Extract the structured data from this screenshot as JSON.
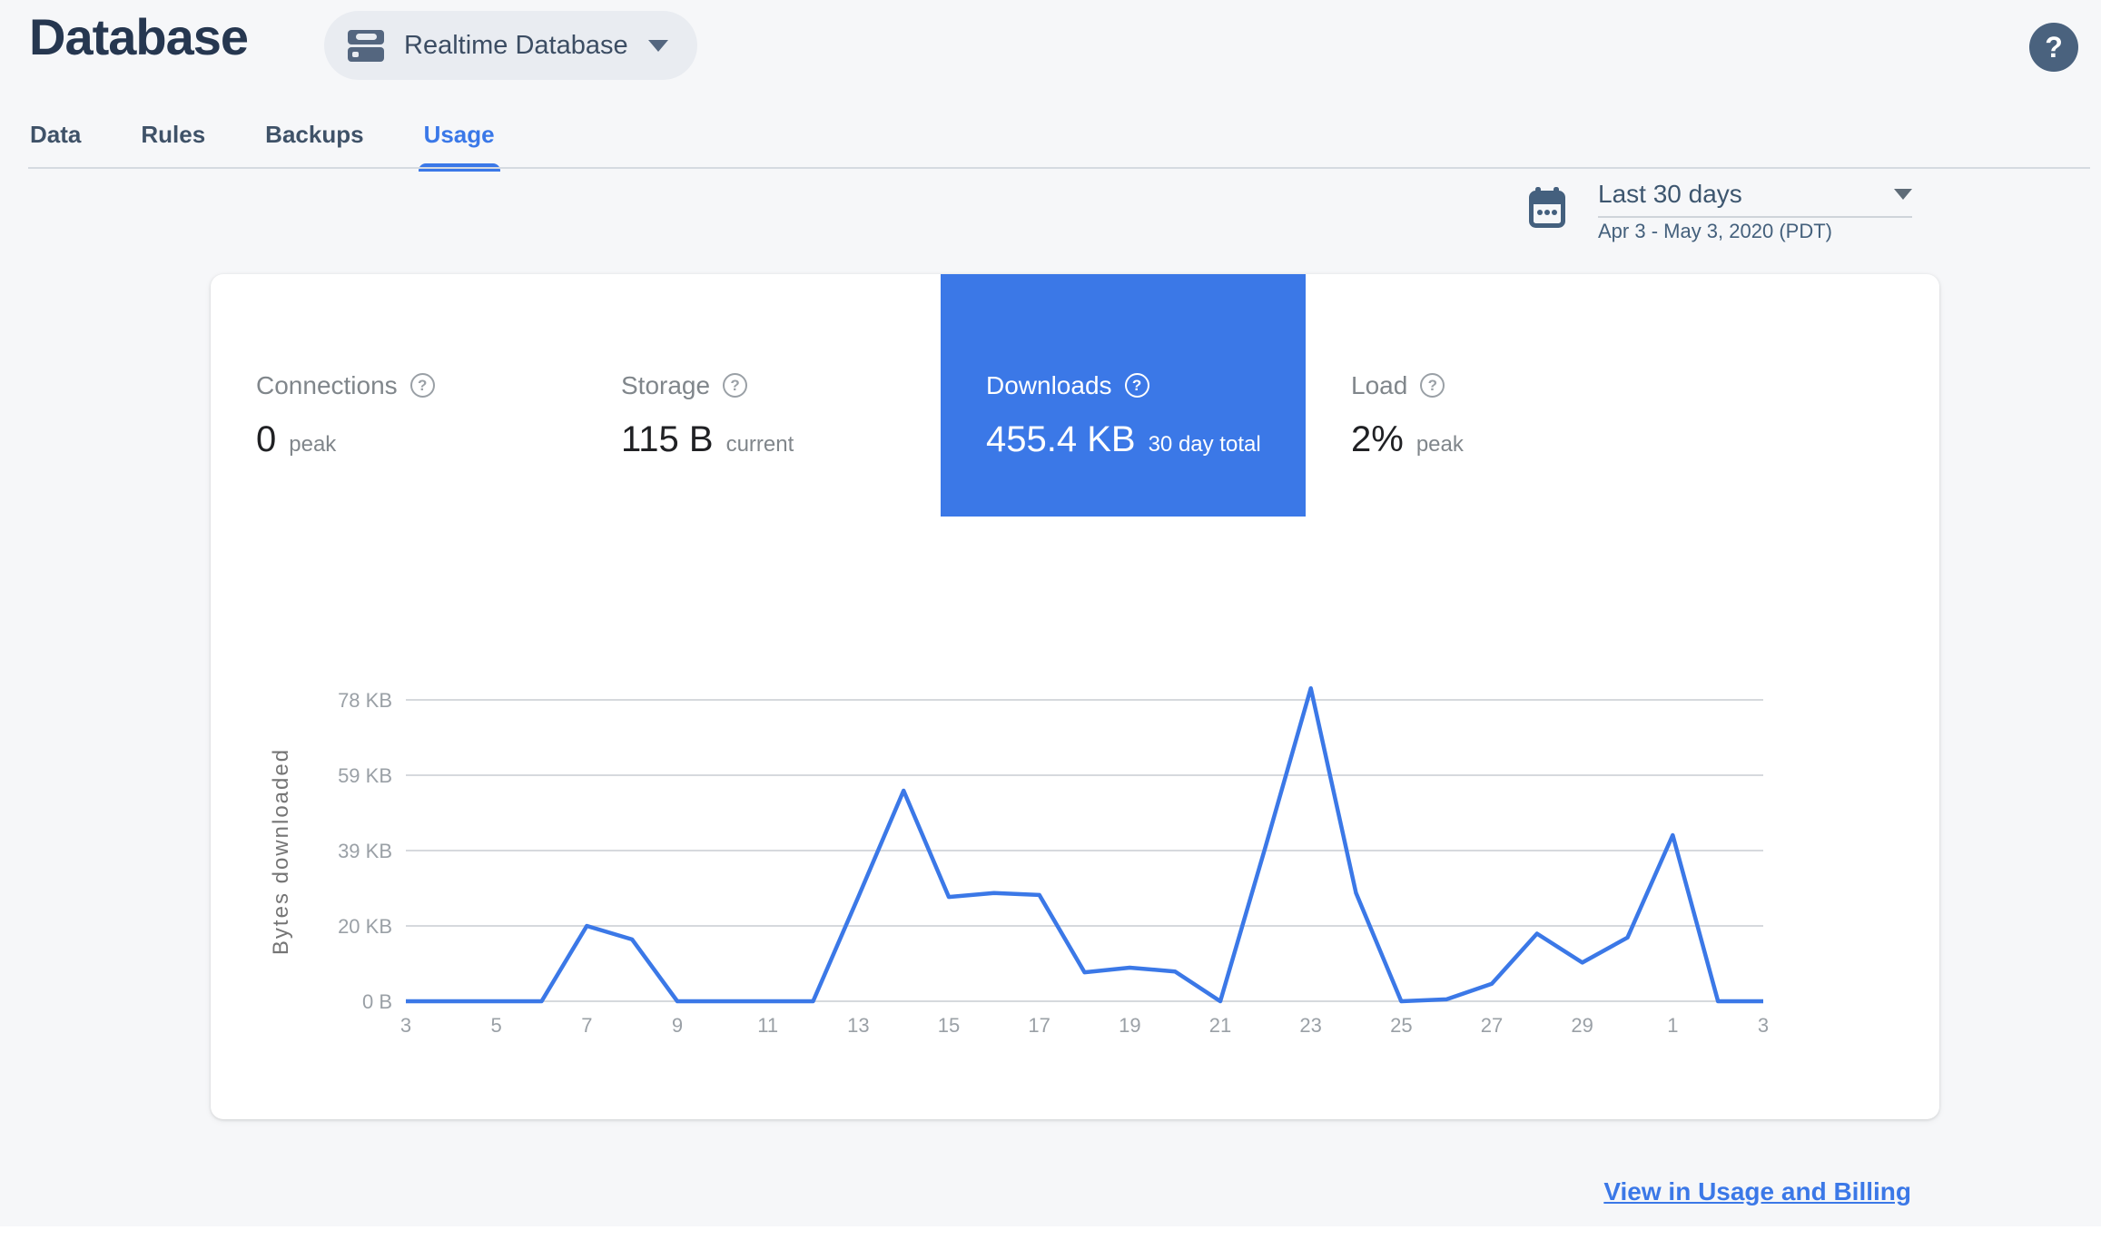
{
  "header": {
    "title": "Database",
    "database_selector": {
      "label": "Realtime Database"
    },
    "help_glyph": "?"
  },
  "tabs": {
    "items": [
      {
        "label": "Data",
        "active": false
      },
      {
        "label": "Rules",
        "active": false
      },
      {
        "label": "Backups",
        "active": false
      },
      {
        "label": "Usage",
        "active": true
      }
    ]
  },
  "date_range": {
    "preset": "Last 30 days",
    "range": "Apr 3 - May 3, 2020 (PDT)"
  },
  "metrics": {
    "help_glyph": "?",
    "items": [
      {
        "id": "connections",
        "label": "Connections",
        "value": "0",
        "unit": "peak",
        "selected": false
      },
      {
        "id": "storage",
        "label": "Storage",
        "value": "115 B",
        "unit": "current",
        "selected": false
      },
      {
        "id": "downloads",
        "label": "Downloads",
        "value": "455.4 KB",
        "unit": "30 day total",
        "selected": true
      },
      {
        "id": "load",
        "label": "Load",
        "value": "2%",
        "unit": "peak",
        "selected": false
      }
    ]
  },
  "chart_data": {
    "type": "line",
    "title": "Downloads - bytes downloaded per day",
    "ylabel": "Bytes downloaded",
    "xlabel": "",
    "x_days": [
      3,
      4,
      5,
      6,
      7,
      8,
      9,
      10,
      11,
      12,
      13,
      14,
      15,
      16,
      17,
      18,
      19,
      20,
      21,
      22,
      23,
      24,
      25,
      26,
      27,
      28,
      29,
      30,
      1,
      2,
      3
    ],
    "values_kb": [
      0,
      0,
      0,
      0,
      19.5,
      16,
      0,
      0,
      0,
      0,
      27,
      54.5,
      27,
      28,
      27.5,
      7.5,
      8.7,
      7.7,
      0,
      40,
      81,
      28,
      0,
      0.5,
      4.5,
      17.5,
      10,
      16.5,
      43,
      0,
      0
    ],
    "ytick_labels": [
      "0 B",
      "20 KB",
      "39 KB",
      "59 KB",
      "78 KB"
    ],
    "ymax_kb": 78,
    "xtick_labels": [
      "3",
      "5",
      "7",
      "9",
      "11",
      "13",
      "15",
      "17",
      "19",
      "21",
      "23",
      "25",
      "27",
      "29",
      "1",
      "3"
    ],
    "line_color": "#3b78e7",
    "grid_color": "#d6d9dd",
    "grid": true,
    "legend": "none"
  },
  "footer": {
    "billing_link": "View in Usage and Billing"
  },
  "colors": {
    "accent_blue": "#3b78e7",
    "selected_tab_bg": "#3b78e7",
    "page_bg": "#f6f7f9",
    "slate": "#4a627e",
    "title_navy": "#263750",
    "gray_label": "#80868b",
    "tick_gray": "#9aa0a6"
  }
}
